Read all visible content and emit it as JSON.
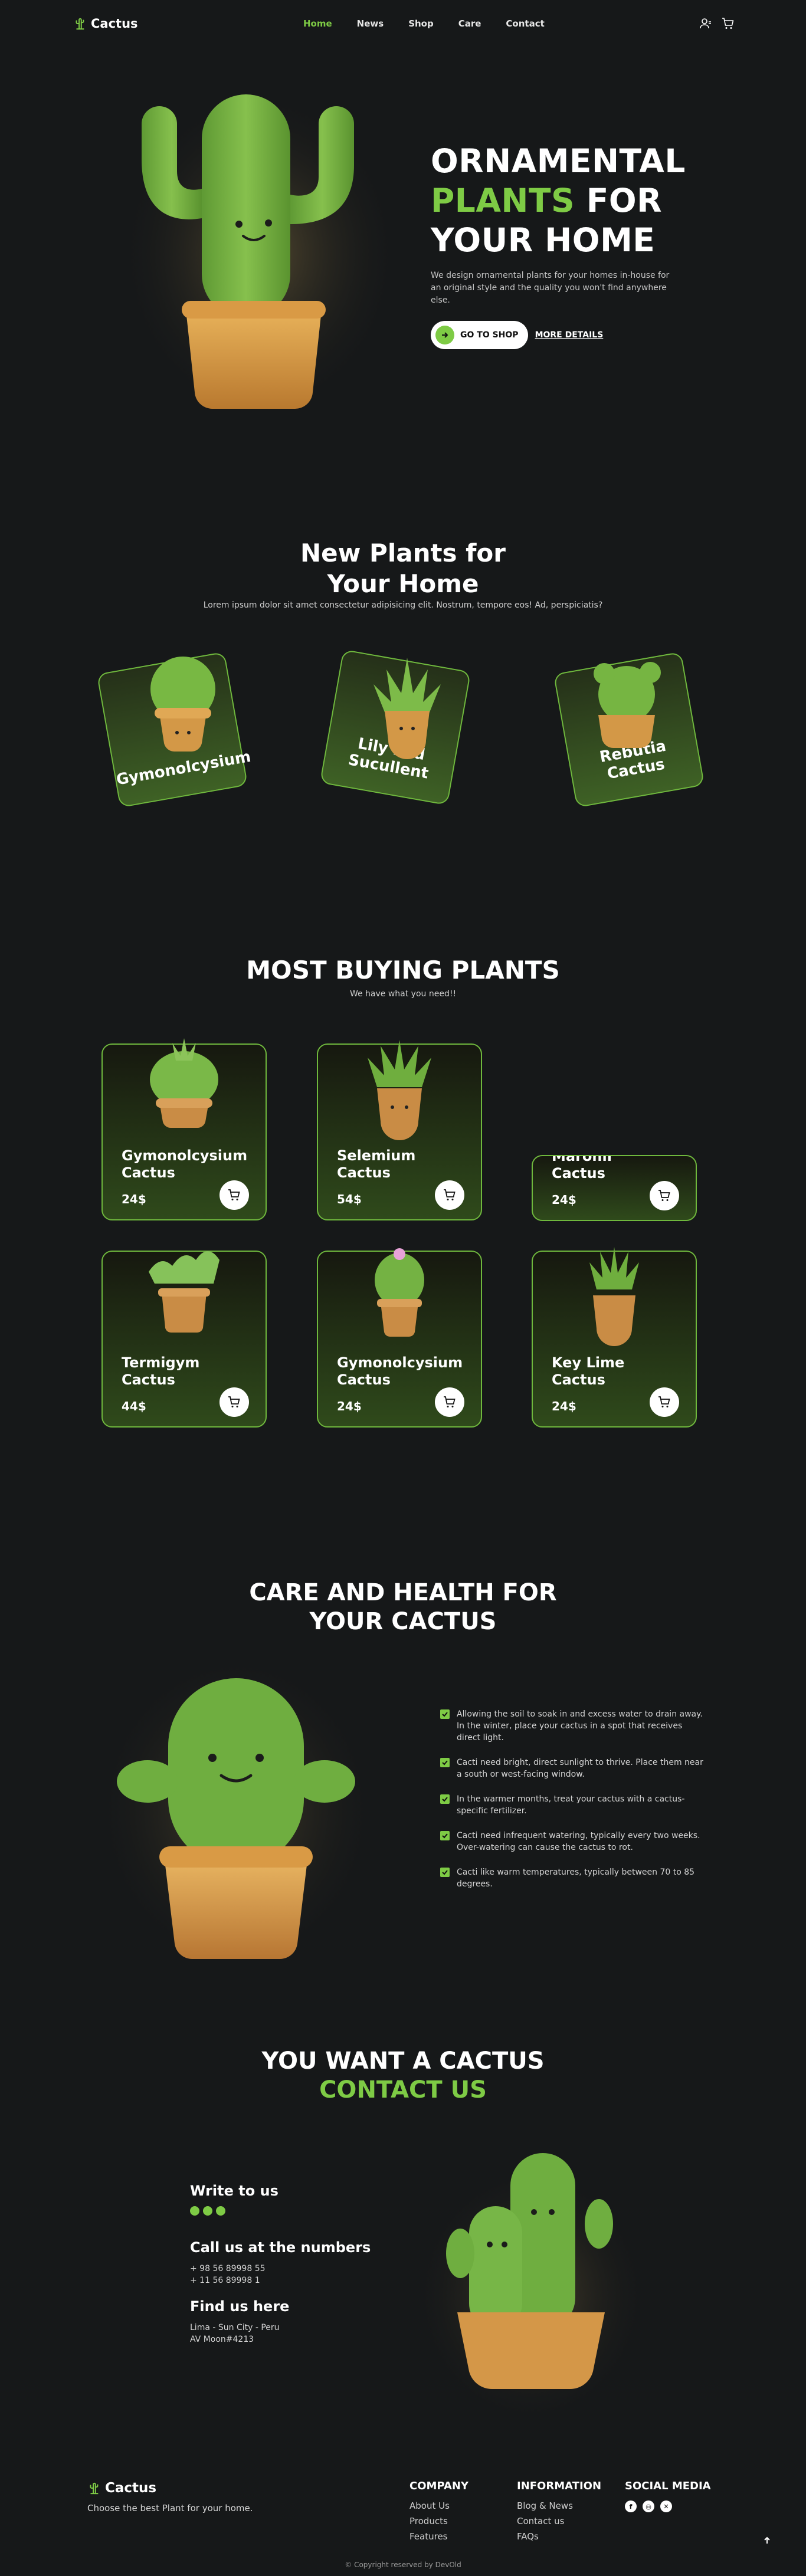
{
  "header": {
    "logo": "Cactus",
    "nav": [
      "Home",
      "News",
      "Shop",
      "Care",
      "Contact"
    ],
    "active_nav": "Home"
  },
  "hero": {
    "title_line1": "ORNAMENTAL",
    "title_line2_green": "PLANTS",
    "title_line2_rest": " FOR",
    "title_line3": "YOUR HOME",
    "description": "We design ornamental plants for your homes in-house for an original style and the quality you won't find anywhere else.",
    "shop_button": "GO TO SHOP",
    "more_link": "MORE DETAILS"
  },
  "new_plants": {
    "title_line1": "New Plants for",
    "title_line2": "Your Home",
    "subtitle": "Lorem ipsum dolor sit amet consectetur adipisicing elit. Nostrum, tempore eos! Ad, perspiciatis?",
    "cards": [
      {
        "name": "Gymonolcysium"
      },
      {
        "name": "Lily Pad Sucullent"
      },
      {
        "name": "Rebutia Cactus"
      }
    ]
  },
  "buying": {
    "title": "MOST BUYING PLANTS",
    "subtitle": "We have what you need!!",
    "cards": [
      {
        "name_l1": "Gymonolcysium",
        "name_l2": "Cactus",
        "price": "24$"
      },
      {
        "name_l1": "Selemium",
        "name_l2": "Cactus",
        "price": "54$"
      },
      {
        "name_l1": "Maronii",
        "name_l2": "Cactus",
        "price": "24$"
      },
      {
        "name_l1": "Termigym",
        "name_l2": "Cactus",
        "price": "44$"
      },
      {
        "name_l1": "Gymonolcysium",
        "name_l2": "Cactus",
        "price": "24$"
      },
      {
        "name_l1": "Key Lime",
        "name_l2": "Cactus",
        "price": "24$"
      }
    ]
  },
  "care": {
    "title_line1": "CARE AND HEALTH FOR",
    "title_line2": "YOUR CACTUS",
    "items": [
      "Allowing the soil to soak in and excess water to drain away. In the winter, place your cactus in a spot that receives direct light.",
      "Cacti need bright, direct sunlight to thrive. Place them near a south or west-facing window.",
      "In the warmer months, treat your cactus with a cactus-specific fertilizer.",
      "Cacti need infrequent watering, typically every two weeks. Over-watering can cause the cactus to rot.",
      "Cacti like warm temperatures, typically between 70 to 85 degrees."
    ]
  },
  "contact": {
    "title_line1": "YOU WANT A CACTUS",
    "title_line2": "CONTACT US",
    "write_title": "Write to us",
    "call_title": "Call us at the numbers",
    "phones": [
      "+ 98 56 89998 55",
      "+ 11 56 89998 1"
    ],
    "find_title": "Find us here",
    "address": [
      "Lima - Sun City - Peru",
      "AV Moon#4213"
    ]
  },
  "footer": {
    "logo": "Cactus",
    "tagline": "Choose the best Plant for your home.",
    "company_title": "COMPANY",
    "company_links": [
      "About Us",
      "Products",
      "Features"
    ],
    "info_title": "INFORMATION",
    "info_links": [
      "Blog & News",
      "Contact us",
      "FAQs"
    ],
    "social_title": "SOCIAL MEDIA",
    "copyright": "© Copyright reserved by DevOld"
  },
  "colors": {
    "accent": "#7ecb45",
    "background": "#161819",
    "card_border": "#6fb83d"
  }
}
